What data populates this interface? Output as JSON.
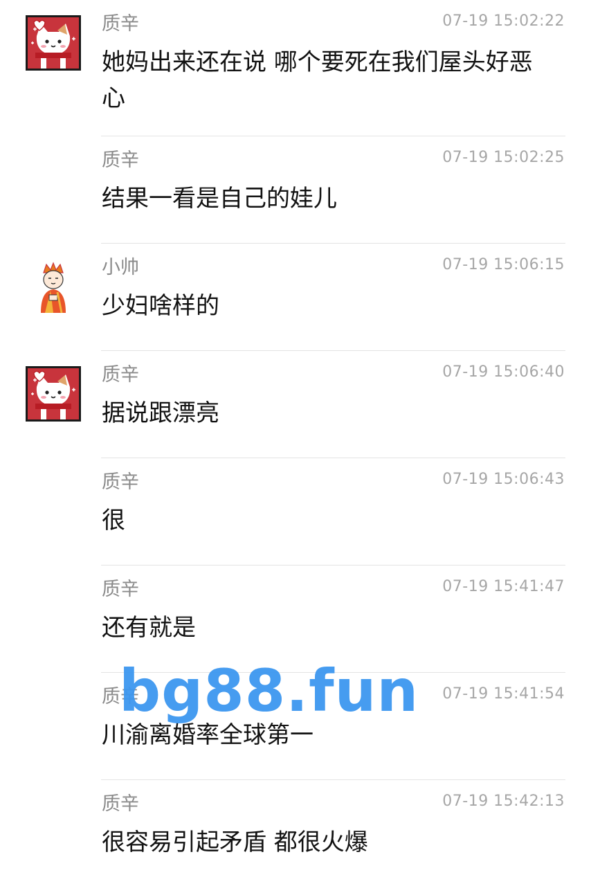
{
  "messages": [
    {
      "sender": "质辛",
      "time": "07-19 15:02:22",
      "text": "她妈出来还在说 哪个要死在我们屋头好恶心",
      "avatar": "cat-avatar"
    },
    {
      "sender": "质辛",
      "time": "07-19 15:02:25",
      "text": "结果一看是自己的娃儿",
      "avatar": ""
    },
    {
      "sender": "小帅",
      "time": "07-19 15:06:15",
      "text": "少妇啥样的",
      "avatar": "monk-avatar"
    },
    {
      "sender": "质辛",
      "time": "07-19 15:06:40",
      "text": "据说跟漂亮",
      "avatar": "cat-avatar"
    },
    {
      "sender": "质辛",
      "time": "07-19 15:06:43",
      "text": "很",
      "avatar": ""
    },
    {
      "sender": "质辛",
      "time": "07-19 15:41:47",
      "text": "还有就是",
      "avatar": ""
    },
    {
      "sender": "质辛",
      "time": "07-19 15:41:54",
      "text": "川渝离婚率全球第一",
      "avatar": ""
    },
    {
      "sender": "质辛",
      "time": "07-19 15:42:13",
      "text": "很容易引起矛盾 都很火爆",
      "avatar": ""
    }
  ],
  "watermark": "bg88.fun",
  "colors": {
    "sender": "#8a8a8a",
    "time": "#a6a6a6",
    "text": "#121212",
    "divider": "#e3e3e3",
    "watermark": "#3d97f0",
    "cat_avatar_bg": "#c8343c"
  }
}
